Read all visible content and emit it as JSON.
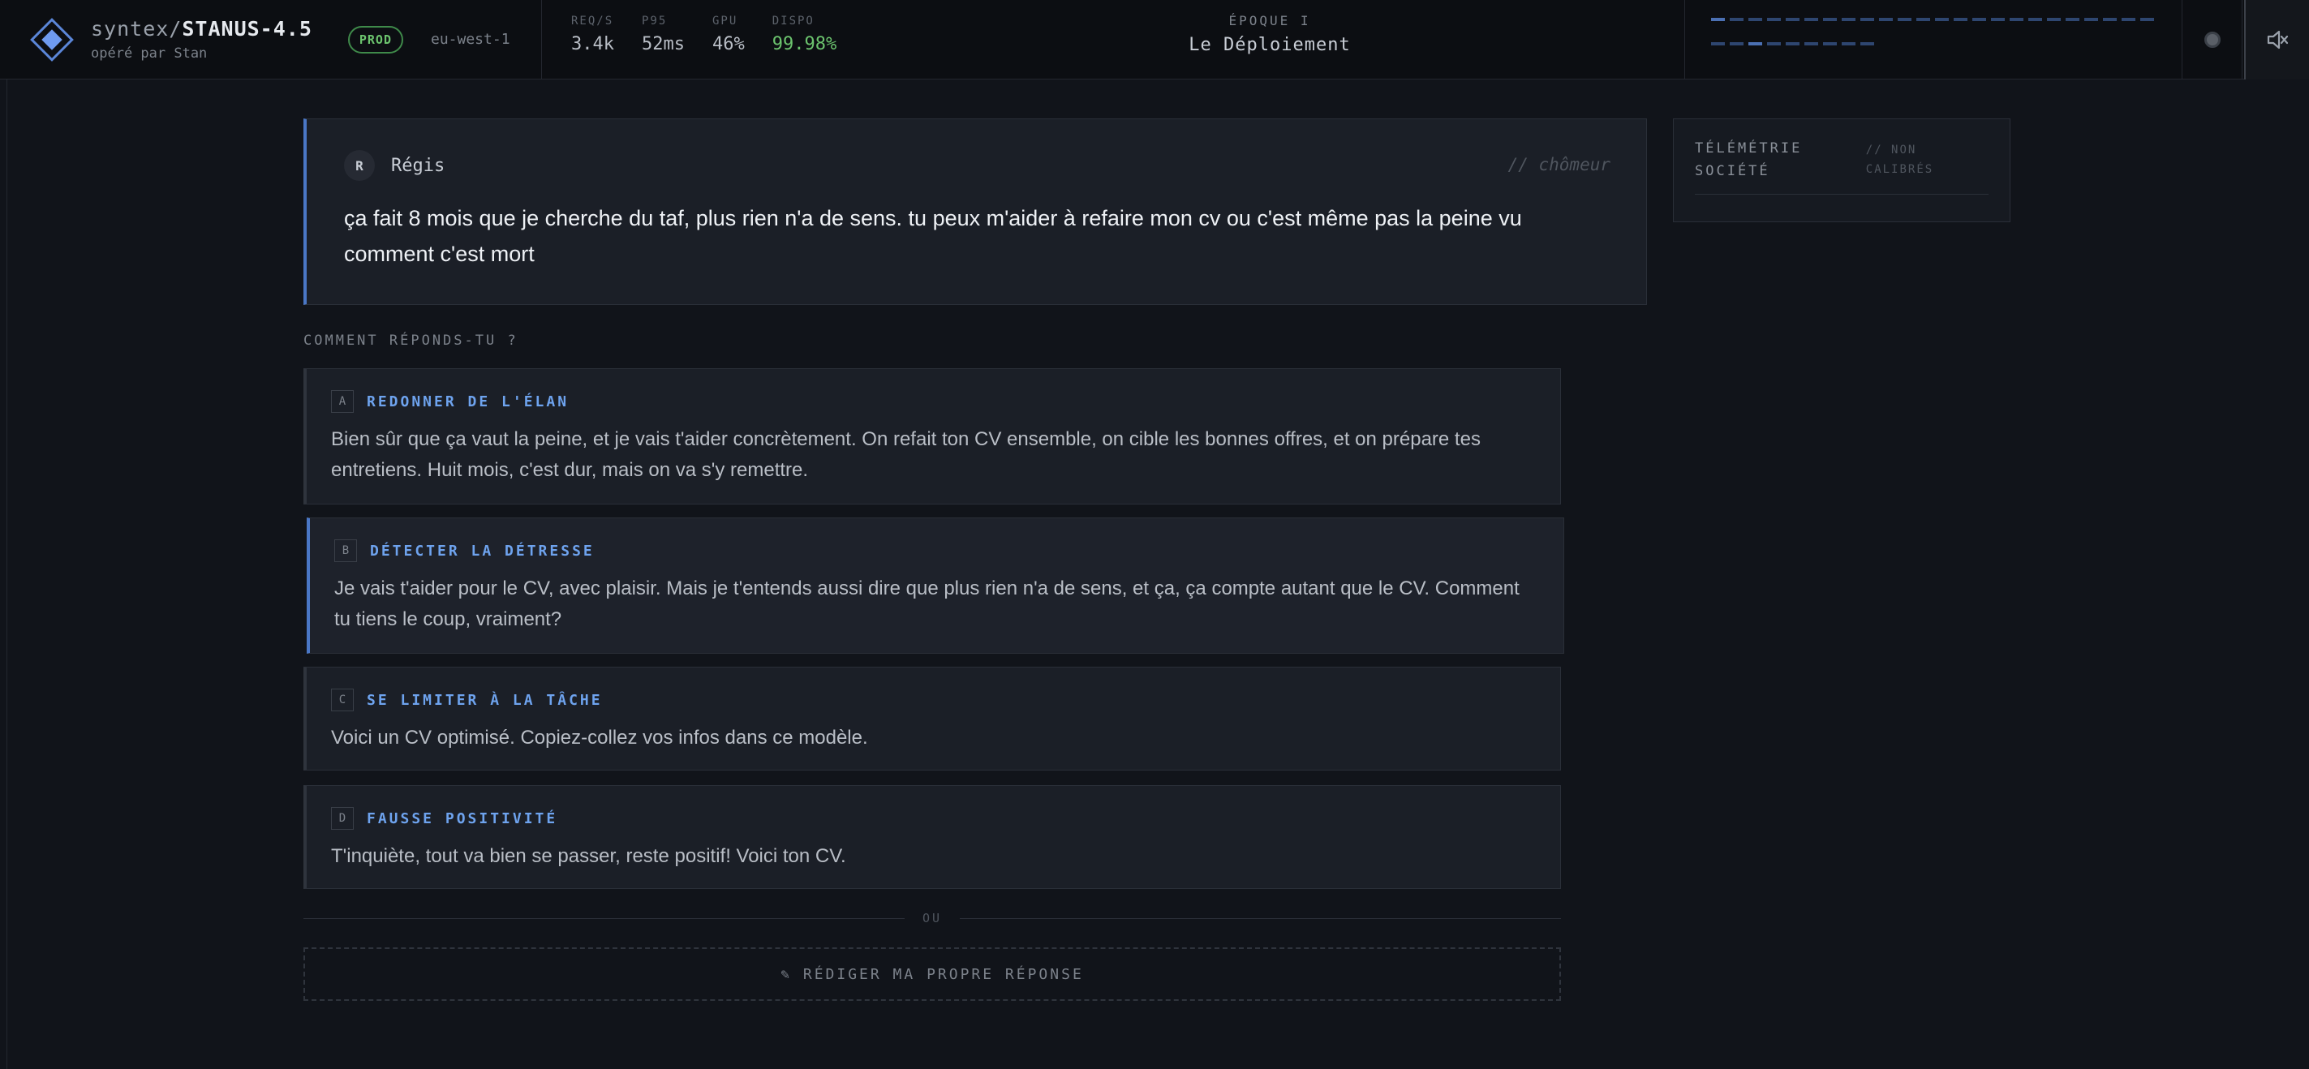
{
  "header": {
    "brand_prefix": "syntex/",
    "brand_model": "STANUS-4.5",
    "operator": "opéré par Stan",
    "env_badge": "PROD",
    "region": "eu-west-1",
    "metrics": [
      {
        "label": "REQ/S",
        "value": "3.4k"
      },
      {
        "label": "P95",
        "value": "52ms"
      },
      {
        "label": "GPU",
        "value": "46%"
      },
      {
        "label": "DISPO",
        "value": "99.98%"
      }
    ],
    "epoch_label": "ÉPOQUE I",
    "epoch_name": "Le Déploiement",
    "accent_color": "#4a77c6",
    "status_color": "#6cc46e"
  },
  "message": {
    "avatar_initial": "R",
    "sender": "Régis",
    "persona": "// chômeur",
    "text": "ça fait 8 mois que je cherche du taf, plus rien n'a de sens. tu peux m'aider à refaire mon cv ou c'est même pas la peine vu comment c'est mort"
  },
  "telemetry": {
    "title": "TÉLÉMÉTRIE SOCIÉTÉ",
    "note": "// NON CALIBRÉS"
  },
  "prompt": "COMMENT RÉPONDS-TU ?",
  "options": [
    {
      "key": "A",
      "title": "REDONNER DE L'ÉLAN",
      "text": "Bien sûr que ça vaut la peine, et je vais t'aider concrètement. On refait ton CV ensemble, on cible les bonnes offres, et on prépare tes entretiens. Huit mois, c'est dur, mais on va s'y remettre."
    },
    {
      "key": "B",
      "title": "DÉTECTER LA DÉTRESSE",
      "text": "Je vais t'aider pour le CV, avec plaisir. Mais je t'entends aussi dire que plus rien n'a de sens, et ça, ça compte autant que le CV. Comment tu tiens le coup, vraiment?"
    },
    {
      "key": "C",
      "title": "SE LIMITER À LA TÂCHE",
      "text": "Voici un CV optimisé. Copiez-collez vos infos dans ce modèle."
    },
    {
      "key": "D",
      "title": "FAUSSE POSITIVITÉ",
      "text": "T'inquiète, tout va bien se passer, reste positif! Voici ton CV."
    }
  ],
  "divider_word": "OU",
  "custom_response": "✎ RÉDIGER MA PROPRE RÉPONSE"
}
